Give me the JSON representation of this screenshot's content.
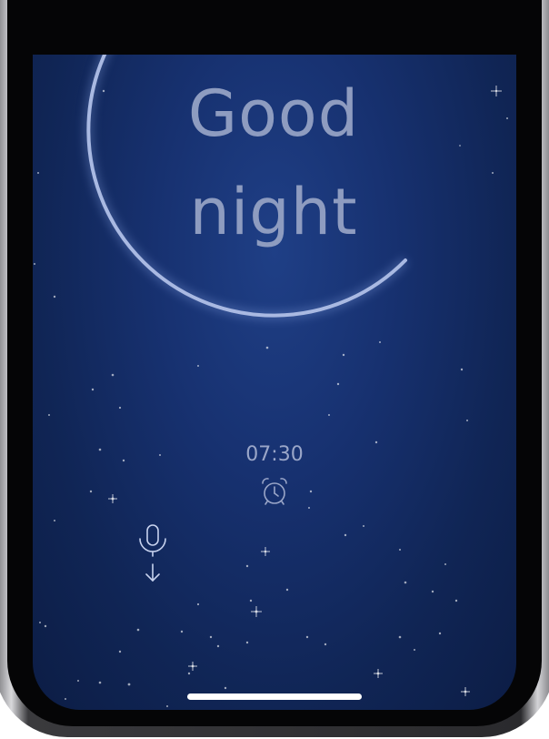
{
  "screen": {
    "greeting_line1": "Good",
    "greeting_line2": "night",
    "alarm_time": "07:30",
    "alarm_icon": "alarm-clock-icon",
    "mic_icon": "microphone-icon",
    "mic_arrow_icon": "arrow-down-icon"
  },
  "colors": {
    "background_top": "#1f3f86",
    "background_bottom": "#0c1d45",
    "arc": "#a9b9e2",
    "greeting_text": "#8e9cc0",
    "alarm_text": "#9aa6c8"
  }
}
